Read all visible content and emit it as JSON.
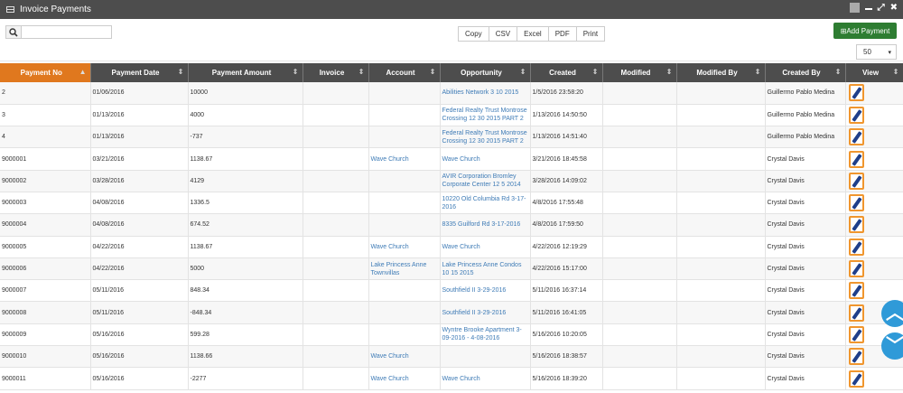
{
  "window": {
    "title": "Invoice Payments"
  },
  "toolbar": {
    "search_value": "",
    "exports": [
      "Copy",
      "CSV",
      "Excel",
      "PDF",
      "Print"
    ],
    "add_label": "⊞Add Payment",
    "page_size": "50"
  },
  "colors": {
    "accent_header": "#e0781e",
    "header_bg": "#4d4d4d",
    "add_button": "#2e7d32",
    "link": "#3e7bb6",
    "scroll_button": "#2f9ad8"
  },
  "table": {
    "columns": [
      "Payment No",
      "Payment Date",
      "Payment Amount",
      "Invoice",
      "Account",
      "Opportunity",
      "Created",
      "Modified",
      "Modified By",
      "Created By",
      "View"
    ],
    "rows": [
      {
        "payment_no": "2",
        "date": "01/06/2016",
        "amount": "10000",
        "invoice": "",
        "account": "",
        "opportunity": "Abilities Network 3 10 2015",
        "created": "1/5/2016 23:58:20",
        "modified": "",
        "modified_by": "",
        "created_by": "Guillermo Pablo Medina"
      },
      {
        "payment_no": "3",
        "date": "01/13/2016",
        "amount": "4000",
        "invoice": "",
        "account": "",
        "opportunity": "Federal Realty Trust Montrose Crossing 12 30 2015 PART 2",
        "created": "1/13/2016 14:50:50",
        "modified": "",
        "modified_by": "",
        "created_by": "Guillermo Pablo Medina"
      },
      {
        "payment_no": "4",
        "date": "01/13/2016",
        "amount": "-737",
        "invoice": "",
        "account": "",
        "opportunity": "Federal Realty Trust Montrose Crossing 12 30 2015 PART 2",
        "created": "1/13/2016 14:51:40",
        "modified": "",
        "modified_by": "",
        "created_by": "Guillermo Pablo Medina"
      },
      {
        "payment_no": "9000001",
        "date": "03/21/2016",
        "amount": "1138.67",
        "invoice": "",
        "account": "Wave Church",
        "opportunity": "Wave Church",
        "created": "3/21/2016 18:45:58",
        "modified": "",
        "modified_by": "",
        "created_by": "Crystal Davis"
      },
      {
        "payment_no": "9000002",
        "date": "03/28/2016",
        "amount": "4129",
        "invoice": "",
        "account": "",
        "opportunity": "AVIR Corporation Bromley Corporate Center 12 5 2014",
        "created": "3/28/2016 14:09:02",
        "modified": "",
        "modified_by": "",
        "created_by": "Crystal Davis"
      },
      {
        "payment_no": "9000003",
        "date": "04/08/2016",
        "amount": "1336.5",
        "invoice": "",
        "account": "",
        "opportunity": "10220 Old Columbia Rd 3-17-2016",
        "created": "4/8/2016 17:55:48",
        "modified": "",
        "modified_by": "",
        "created_by": "Crystal Davis"
      },
      {
        "payment_no": "9000004",
        "date": "04/08/2016",
        "amount": "674.52",
        "invoice": "",
        "account": "",
        "opportunity": "8335 Guilford Rd 3-17-2016",
        "created": "4/8/2016 17:59:50",
        "modified": "",
        "modified_by": "",
        "created_by": "Crystal Davis"
      },
      {
        "payment_no": "9000005",
        "date": "04/22/2016",
        "amount": "1138.67",
        "invoice": "",
        "account": "Wave Church",
        "opportunity": "Wave Church",
        "created": "4/22/2016 12:19:29",
        "modified": "",
        "modified_by": "",
        "created_by": "Crystal Davis"
      },
      {
        "payment_no": "9000006",
        "date": "04/22/2016",
        "amount": "5000",
        "invoice": "",
        "account": "Lake Princess Anne Townvillas",
        "opportunity": "Lake Princess Anne Condos 10 15 2015",
        "created": "4/22/2016 15:17:00",
        "modified": "",
        "modified_by": "",
        "created_by": "Crystal Davis"
      },
      {
        "payment_no": "9000007",
        "date": "05/11/2016",
        "amount": "848.34",
        "invoice": "",
        "account": "",
        "opportunity": "Southfield II 3-29-2016",
        "created": "5/11/2016 16:37:14",
        "modified": "",
        "modified_by": "",
        "created_by": "Crystal Davis"
      },
      {
        "payment_no": "9000008",
        "date": "05/11/2016",
        "amount": "-848.34",
        "invoice": "",
        "account": "",
        "opportunity": "Southfield II 3-29-2016",
        "created": "5/11/2016 16:41:05",
        "modified": "",
        "modified_by": "",
        "created_by": "Crystal Davis"
      },
      {
        "payment_no": "9000009",
        "date": "05/16/2016",
        "amount": "599.28",
        "invoice": "",
        "account": "",
        "opportunity": "Wyntre Brooke Apartment 3-09-2016 - 4-08-2016",
        "created": "5/16/2016 10:20:05",
        "modified": "",
        "modified_by": "",
        "created_by": "Crystal Davis"
      },
      {
        "payment_no": "9000010",
        "date": "05/16/2016",
        "amount": "1138.66",
        "invoice": "",
        "account": "Wave Church",
        "opportunity": "",
        "created": "5/16/2016 18:38:57",
        "modified": "",
        "modified_by": "",
        "created_by": "Crystal Davis"
      },
      {
        "payment_no": "9000011",
        "date": "05/16/2016",
        "amount": "-2277",
        "invoice": "",
        "account": "Wave Church",
        "opportunity": "Wave Church",
        "created": "5/16/2016 18:39:20",
        "modified": "",
        "modified_by": "",
        "created_by": "Crystal Davis"
      }
    ]
  }
}
